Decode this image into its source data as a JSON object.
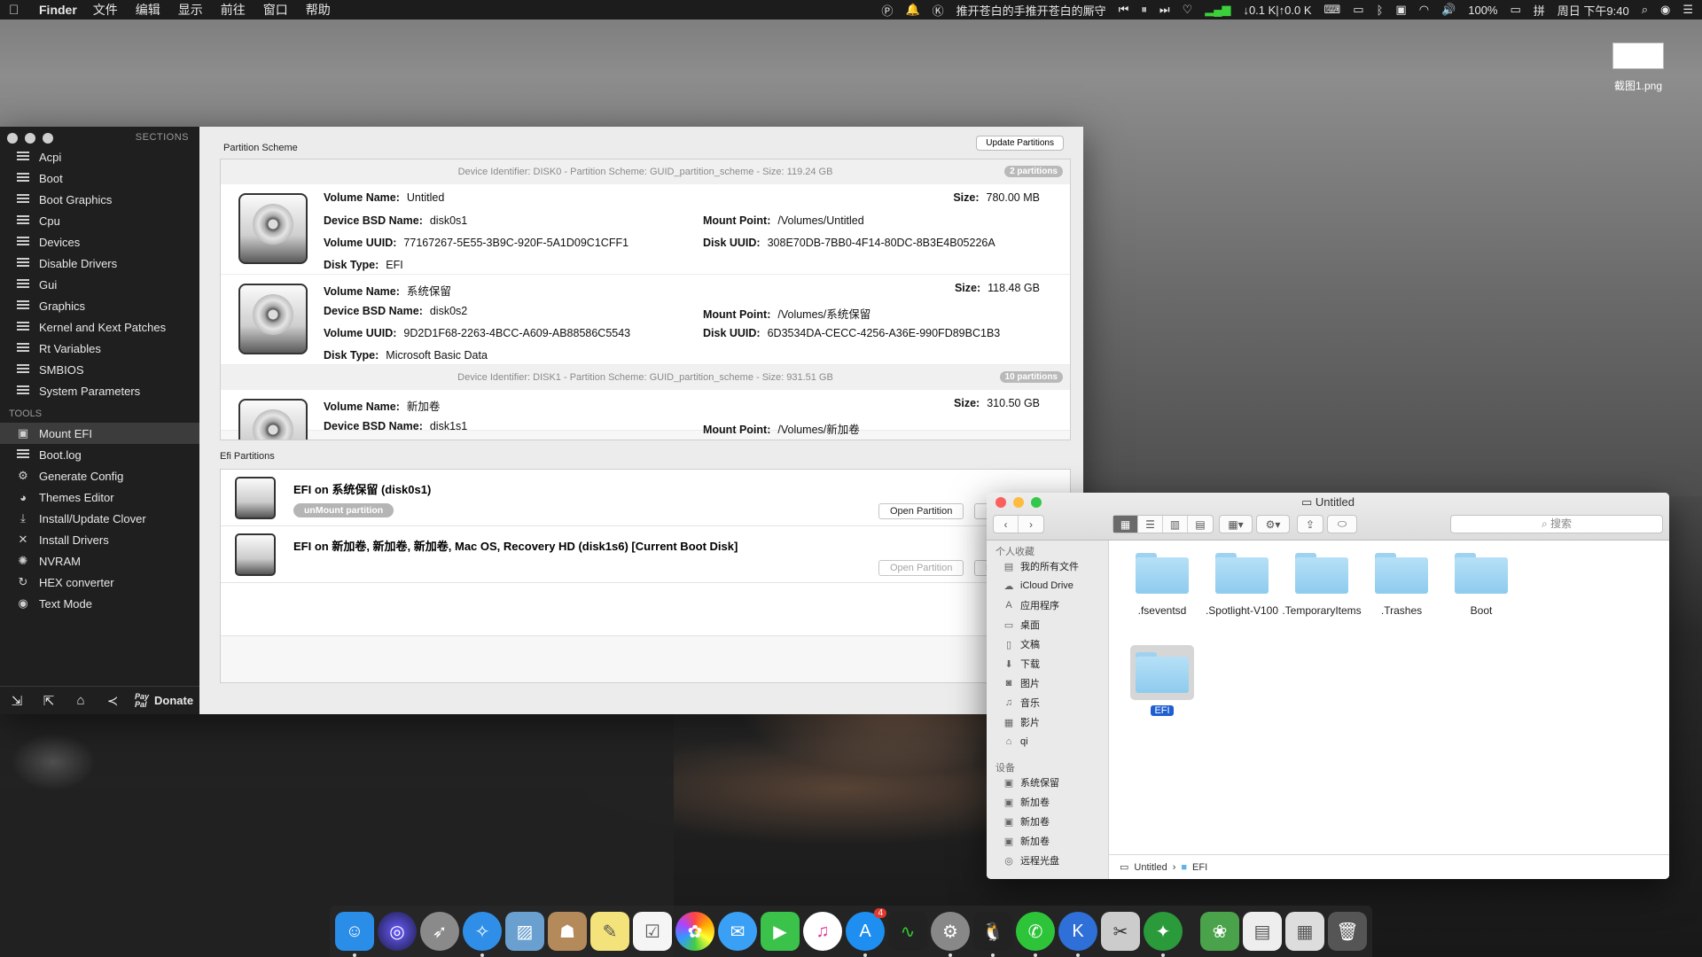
{
  "menubar": {
    "app": "Finder",
    "items": [
      "文件",
      "编辑",
      "显示",
      "前往",
      "窗口",
      "帮助"
    ],
    "now_playing": "推开苍白的手推开苍白的厮守",
    "network": "↓0.1 K|↑0.0 K",
    "battery": "100%",
    "clock": "周日 下午9:40"
  },
  "desktop_file": {
    "name": "截图1.png"
  },
  "clover": {
    "sections_label": "SECTIONS",
    "sections": [
      "Acpi",
      "Boot",
      "Boot Graphics",
      "Cpu",
      "Devices",
      "Disable Drivers",
      "Gui",
      "Graphics",
      "Kernel and Kext Patches",
      "Rt Variables",
      "SMBIOS",
      "System Parameters"
    ],
    "tools_label": "TOOLS",
    "tools": [
      {
        "label": "Mount EFI",
        "icon": "mount-icon"
      },
      {
        "label": "Boot.log",
        "icon": "list-icon"
      },
      {
        "label": "Generate Config",
        "icon": "gear-icon"
      },
      {
        "label": "Themes Editor",
        "icon": "palette-icon"
      },
      {
        "label": "Install/Update Clover",
        "icon": "download-icon"
      },
      {
        "label": "Install Drivers",
        "icon": "tools-icon"
      },
      {
        "label": "NVRAM",
        "icon": "chip-icon"
      },
      {
        "label": "HEX converter",
        "icon": "refresh-icon"
      },
      {
        "label": "Text Mode",
        "icon": "eye-icon"
      }
    ],
    "donate_label": "Donate",
    "paypal_top": "Pay",
    "paypal_bottom": "Pal",
    "partition_scheme_title": "Partition Scheme",
    "update_button": "Update Partitions",
    "disk0_header": "Device Identifier: DISK0 - Partition Scheme: GUID_partition_scheme - Size: 119.24 GB",
    "disk0_badge": "2 partitions",
    "disk1_header": "Device Identifier: DISK1 - Partition Scheme: GUID_partition_scheme - Size: 931.51 GB",
    "disk1_badge": "10 partitions",
    "labels": {
      "volume_name": "Volume Name:",
      "bsd_name": "Device BSD Name:",
      "volume_uuid": "Volume UUID:",
      "disk_type": "Disk Type:",
      "size": "Size:",
      "mount_point": "Mount Point:",
      "disk_uuid": "Disk UUID:"
    },
    "volumes": [
      {
        "name": "Untitled",
        "bsd": "disk0s1",
        "uuid": "77167267-5E55-3B9C-920F-5A1D09C1CFF1",
        "type": "EFI",
        "size": "780.00 MB",
        "mount": "/Volumes/Untitled",
        "disk_uuid": "308E70DB-7BB0-4F14-80DC-8B3E4B05226A"
      },
      {
        "name": "系统保留",
        "bsd": "disk0s2",
        "uuid": "9D2D1F68-2263-4BCC-A609-AB88586C5543",
        "type": "Microsoft Basic Data",
        "size": "118.48 GB",
        "mount": "/Volumes/系统保留",
        "disk_uuid": "6D3534DA-CECC-4256-A36E-990FD89BC1B3"
      },
      {
        "name": "新加卷",
        "bsd": "disk1s1",
        "size": "310.50 GB",
        "mount": "/Volumes/新加卷"
      }
    ],
    "efi_title": "Efi Partitions",
    "efi": [
      {
        "name": "EFI on 系统保留 (disk0s1)",
        "unmount": "unMount partition",
        "open": "Open Partition",
        "mount": "Mou"
      },
      {
        "name": "EFI on 新加卷, 新加卷, 新加卷, Mac OS, Recovery HD (disk1s6) [Current Boot Disk]",
        "open": "Open Partition",
        "mount": "Mou"
      }
    ]
  },
  "finder": {
    "title": "Untitled",
    "search_placeholder": "搜索",
    "favorites_label": "个人收藏",
    "favorites": [
      {
        "label": "我的所有文件",
        "icon": "all-files-icon"
      },
      {
        "label": "iCloud Drive",
        "icon": "cloud-icon"
      },
      {
        "label": "应用程序",
        "icon": "apps-icon"
      },
      {
        "label": "桌面",
        "icon": "desktop-icon"
      },
      {
        "label": "文稿",
        "icon": "documents-icon"
      },
      {
        "label": "下载",
        "icon": "download-icon"
      },
      {
        "label": "图片",
        "icon": "camera-icon"
      },
      {
        "label": "音乐",
        "icon": "music-icon"
      },
      {
        "label": "影片",
        "icon": "film-icon"
      },
      {
        "label": "qi",
        "icon": "home-icon"
      }
    ],
    "devices_label": "设备",
    "devices": [
      "系统保留",
      "新加卷",
      "新加卷",
      "新加卷",
      "远程光盘"
    ],
    "folders": [
      ".fseventsd",
      ".Spotlight-V100",
      ".TemporaryItems",
      ".Trashes",
      "Boot",
      "EFI"
    ],
    "path": [
      "Untitled",
      "EFI"
    ]
  },
  "dock": {
    "apps": [
      "Finder",
      "Siri",
      "Launchpad",
      "Safari",
      "Preview",
      "Contacts",
      "Notes",
      "Reminders",
      "Photos",
      "Messages",
      "FaceTime",
      "iTunes",
      "App Store",
      "Activity Monitor",
      "System Preferences",
      "QQ",
      "WeChat",
      "Clover Configurator",
      "Screenshot",
      "Vibrant"
    ],
    "app_store_badge": "4"
  }
}
